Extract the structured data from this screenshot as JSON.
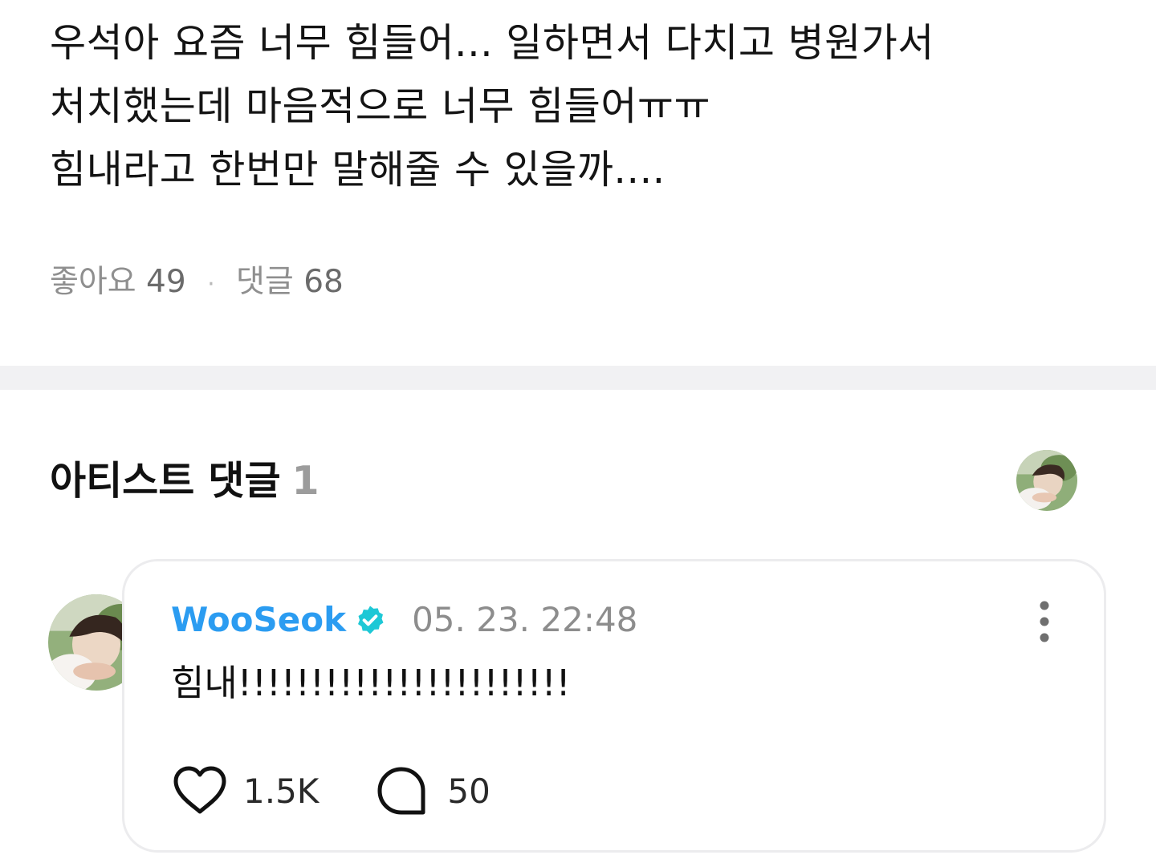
{
  "post": {
    "lines": [
      "우석아 요즘 너무 힘들어... 일하면서 다치고 병원가서",
      "처치했는데 마음적으로 너무 힘들어ㅠㅠ",
      "힘내라고 한번만 말해줄 수 있을까...."
    ],
    "stats": {
      "likes_label": "좋아요",
      "likes_count": "49",
      "separator": "·",
      "comments_label": "댓글",
      "comments_count": "68"
    }
  },
  "artist_comments": {
    "title": "아티스트 댓글",
    "count": "1",
    "header_avatar_icon": "artist-avatar-icon"
  },
  "comment": {
    "author": "WooSeok",
    "verified_icon": "verified-badge-icon",
    "timestamp": "05. 23. 22:48",
    "text": "힘내!!!!!!!!!!!!!!!!!!!!!!!",
    "likes": "1.5K",
    "replies": "50",
    "more_icon": "more-vertical-icon",
    "like_icon": "heart-icon",
    "reply_icon": "speech-bubble-icon"
  },
  "colors": {
    "author": "#2b9cf1",
    "verified": "#1ec8d6",
    "muted": "#8d8d8d",
    "divider": "#f1f1f3",
    "card_border": "#ececee"
  }
}
